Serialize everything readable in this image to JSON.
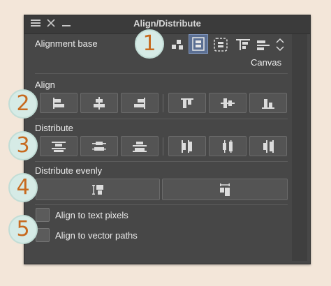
{
  "window": {
    "title": "Align/Distribute",
    "menu_icon": "hamburger-icon",
    "close_icon": "close-icon",
    "minimize_icon": "minimize-icon"
  },
  "alignment_base": {
    "label": "Alignment base",
    "options": [
      "selection-objects-icon",
      "canvas-icon",
      "selection-area-icon",
      "key-object-icon",
      "guide-icon"
    ],
    "selected": "Canvas",
    "more_icon": "chevron-updown-icon"
  },
  "align": {
    "label": "Align",
    "buttons": [
      "align-left-icon",
      "align-horizontal-center-icon",
      "align-right-icon",
      "align-top-icon",
      "align-vertical-center-icon",
      "align-bottom-icon"
    ]
  },
  "distribute": {
    "label": "Distribute",
    "buttons": [
      "distribute-top-icon",
      "distribute-vertical-center-icon",
      "distribute-bottom-icon",
      "distribute-left-icon",
      "distribute-horizontal-center-icon",
      "distribute-right-icon"
    ]
  },
  "distribute_evenly": {
    "label": "Distribute evenly",
    "buttons": [
      "distribute-evenly-vertical-icon",
      "distribute-evenly-horizontal-icon"
    ]
  },
  "options": {
    "text_pixels": {
      "label": "Align to text pixels",
      "checked": false
    },
    "vector_paths": {
      "label": "Align to vector paths",
      "checked": false
    }
  },
  "badges": [
    "1",
    "2",
    "3",
    "4",
    "5"
  ],
  "colors": {
    "badge_text": "#c76a1f",
    "badge_bg": "#d6ebe6",
    "selected": "#5b6f93",
    "panel": "#474747"
  }
}
